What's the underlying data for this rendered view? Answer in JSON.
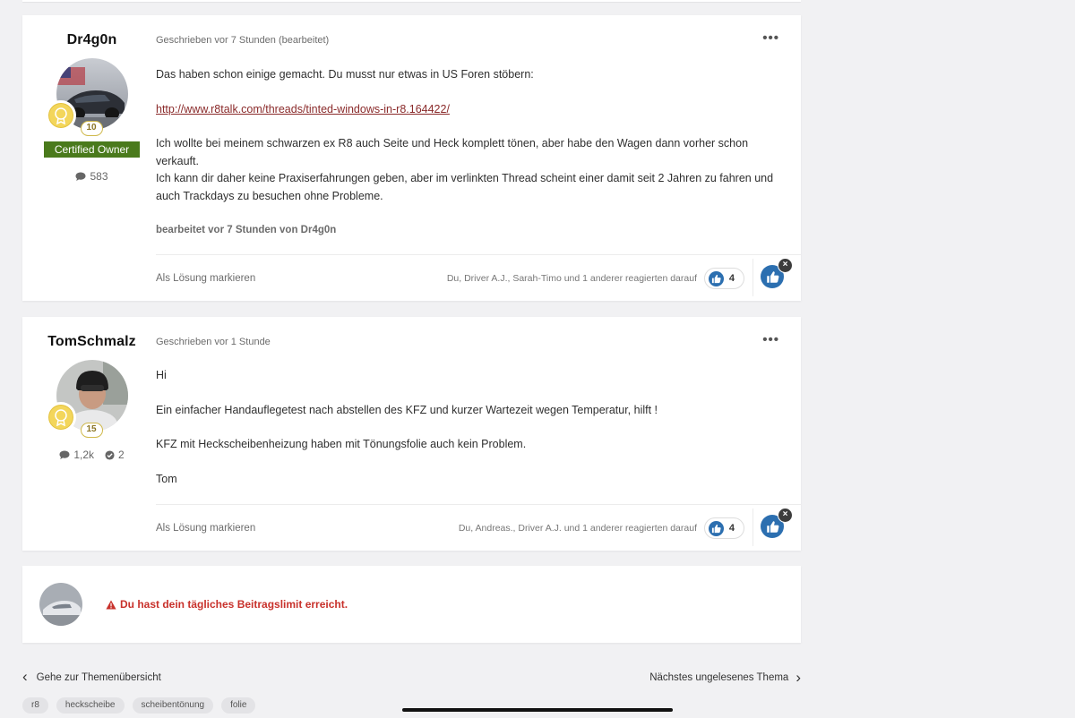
{
  "posts": [
    {
      "author": "Dr4g0n",
      "rep_count": "10",
      "owner_badge": "Certified Owner",
      "posts_count": "583",
      "meta": "Geschrieben vor 7 Stunden (bearbeitet)",
      "more_label": "•••",
      "body": {
        "p1": "Das haben schon einige gemacht. Du musst nur etwas in US Foren stöbern:",
        "link": "http://www.r8talk.com/threads/tinted-windows-in-r8.164422/",
        "p3a": "Ich wollte bei meinem schwarzen ex R8 auch Seite und Heck komplett tönen, aber habe den Wagen dann vorher schon verkauft.",
        "p3b": "Ich kann dir daher keine Praxiserfahrungen geben, aber im verlinkten Thread scheint einer damit seit 2 Jahren zu fahren und auch Trackdays zu besuchen ohne Probleme.",
        "edited": "bearbeitet vor 7 Stunden von Dr4g0n"
      },
      "footer": {
        "mark_solution": "Als Lösung markieren",
        "reactors": "Du, Driver A.J., Sarah-Timo und 1 anderer reagierten darauf",
        "reaction_count": "4",
        "remove_label": "×"
      }
    },
    {
      "author": "TomSchmalz",
      "rep_count": "15",
      "posts_count": "1,2k",
      "solutions_count": "2",
      "meta": "Geschrieben vor 1 Stunde",
      "more_label": "•••",
      "body": {
        "p1": "Hi",
        "p2": "Ein einfacher Handauflegetest nach abstellen des KFZ und kurzer Wartezeit wegen Temperatur, hilft  !",
        "p3": "KFZ mit Heckscheibenheizung haben mit Tönungsfolie auch kein Problem.",
        "p4": "Tom"
      },
      "footer": {
        "mark_solution": "Als Lösung markieren",
        "reactors": "Du, Andreas., Driver A.J. und 1 anderer reagierten darauf",
        "reaction_count": "4",
        "remove_label": "×"
      }
    }
  ],
  "limit": {
    "message": "Du hast dein tägliches Beitragslimit erreicht."
  },
  "navigation": {
    "back_label": "Gehe zur Themenübersicht",
    "next_label": "Nächstes ungelesenes Thema",
    "back_chevron": "‹",
    "next_chevron": "›"
  },
  "tags": [
    "r8",
    "heckscheibe",
    "scheibentönung",
    "folie"
  ],
  "colors": {
    "accent_blue": "#2c6fb0",
    "owner_green": "#4a7a1c",
    "error_red": "#c8312b",
    "link_red": "#8a2a2a"
  }
}
